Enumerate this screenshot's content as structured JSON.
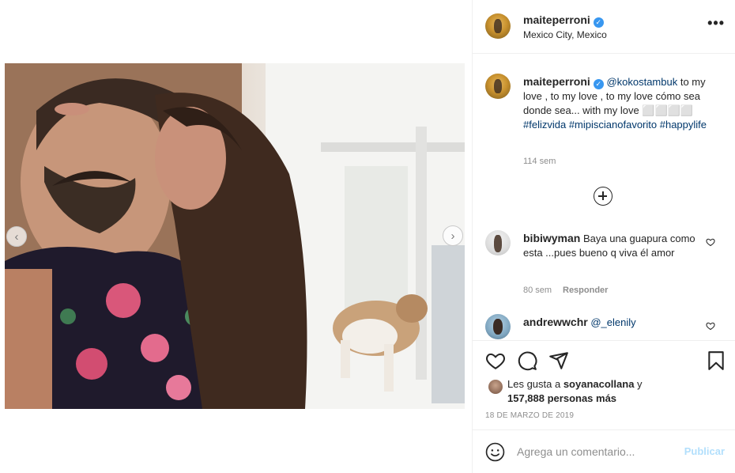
{
  "post": {
    "username": "maiteperroni",
    "location": "Mexico City, Mexico",
    "more_label": "•••"
  },
  "caption": {
    "username": "maiteperroni",
    "mention": "@kokostambuk",
    "text": " to my love , to my love , to my love cómo sea donde sea... with my love ⬜⬜⬜⬜",
    "tag1": "#felizvida",
    "tag2": "#mipiscianofavorito",
    "tag3": "#happylife",
    "time": "114 sem"
  },
  "comments": [
    {
      "username": "bibiwyman",
      "text": "Baya una guapura como esta ...pues bueno q viva él amor",
      "time": "80 sem",
      "reply": "Responder"
    },
    {
      "username": "andrewwchr",
      "text": "@_elenily"
    }
  ],
  "likes": {
    "prefix": "Les gusta a ",
    "user": "soyanacollana",
    "middle": " y",
    "count": "157,888 personas más"
  },
  "date": "18 DE MARZO DE 2019",
  "composer": {
    "placeholder": "Agrega un comentario...",
    "publish_label": "Publicar"
  },
  "nav": {
    "prev": "‹",
    "next": "›"
  },
  "colors": {
    "link": "#00376b",
    "verified": "#3897f0",
    "publish_disabled": "#b2dffc",
    "meta_gray": "#8e8e8e"
  },
  "icons": [
    "heart-icon",
    "comment-icon",
    "share-icon",
    "bookmark-icon",
    "emoji-icon",
    "plus-circle-icon",
    "verified-badge-icon",
    "more-options-icon"
  ]
}
